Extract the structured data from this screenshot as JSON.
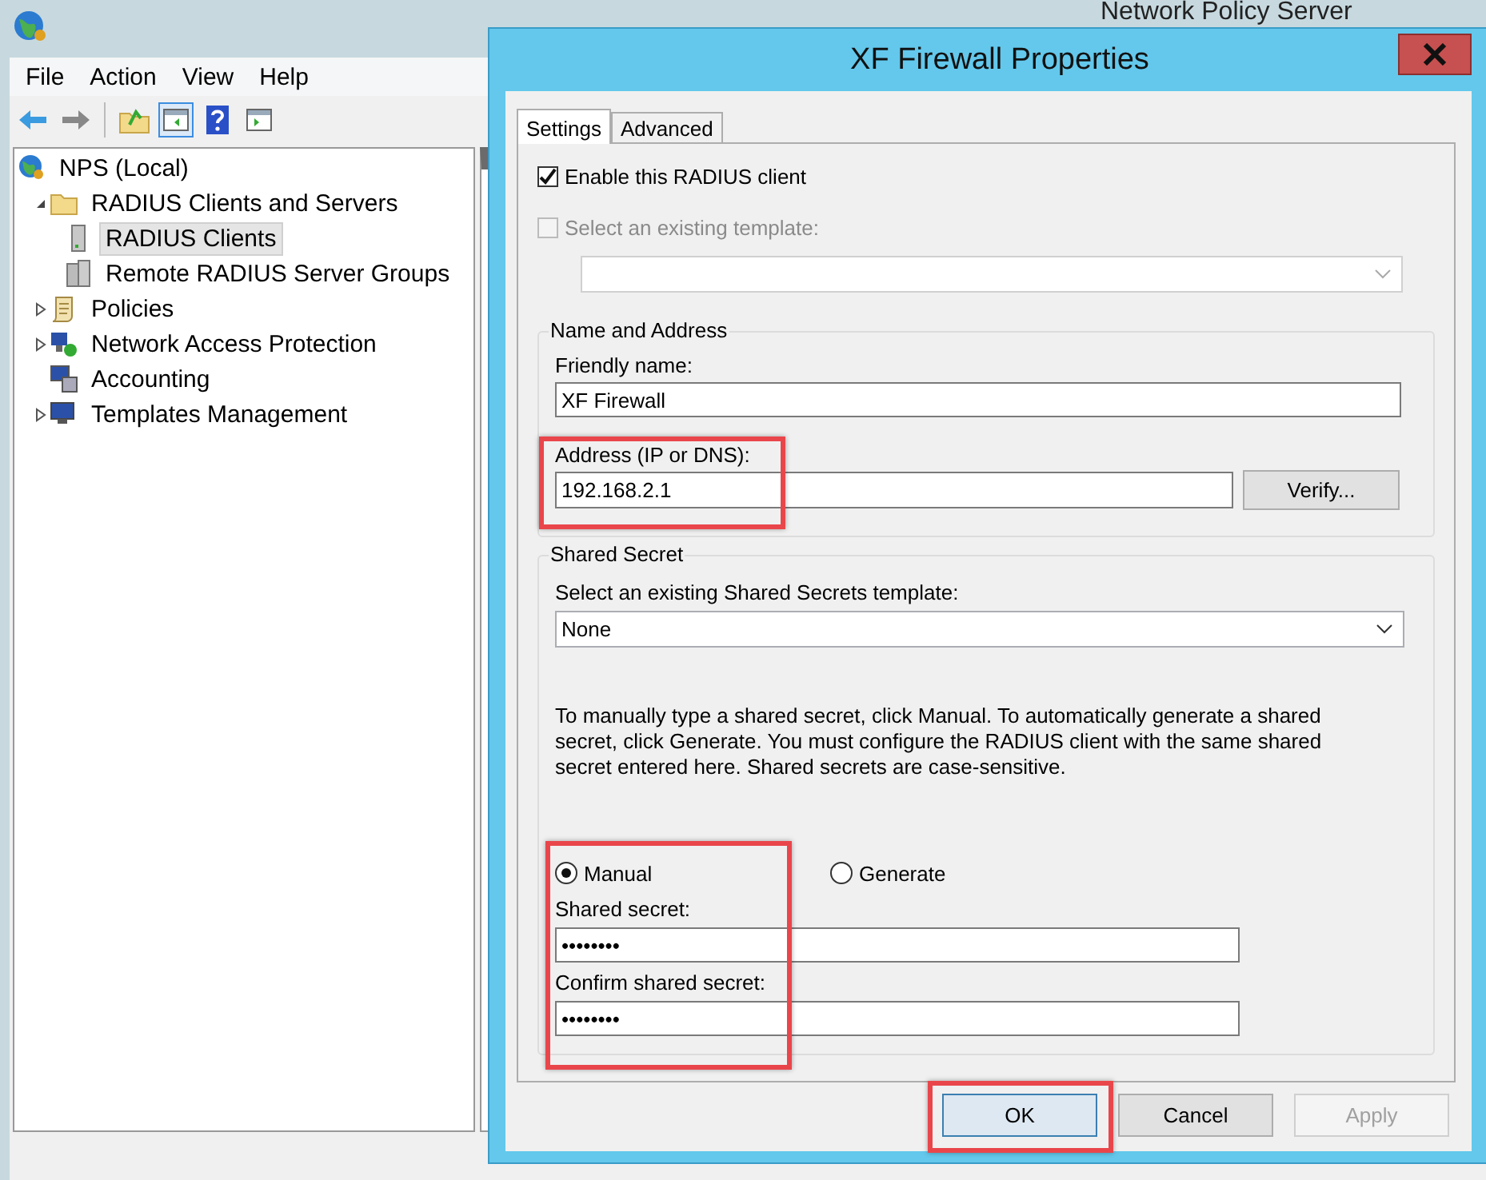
{
  "main_window": {
    "title": "Network Policy Server",
    "menu": [
      "File",
      "Action",
      "View",
      "Help"
    ],
    "tree": [
      {
        "label": "NPS (Local)",
        "kind": "globe",
        "selected": false,
        "children": [
          {
            "label": "RADIUS Clients and Servers",
            "kind": "folder",
            "expanded": true,
            "selected": false,
            "children": [
              {
                "label": "RADIUS Clients",
                "kind": "server",
                "selected": true
              },
              {
                "label": "Remote RADIUS Server Groups",
                "kind": "servers",
                "selected": false
              }
            ]
          },
          {
            "label": "Policies",
            "kind": "scroll",
            "expanded": false,
            "selected": false
          },
          {
            "label": "Network Access Protection",
            "kind": "network",
            "expanded": false,
            "selected": false
          },
          {
            "label": "Accounting",
            "kind": "accounting",
            "selected": false
          },
          {
            "label": "Templates Management",
            "kind": "monitor",
            "expanded": false,
            "selected": false
          }
        ]
      }
    ]
  },
  "dialog": {
    "title": "XF Firewall Properties",
    "tabs": [
      {
        "label": "Settings",
        "selected": true
      },
      {
        "label": "Advanced",
        "selected": false
      }
    ],
    "enable_client": {
      "label": "Enable this RADIUS client",
      "checked": true
    },
    "template": {
      "label": "Select an existing template:",
      "checked": false,
      "disabled": true
    },
    "name_address": {
      "legend": "Name and Address",
      "friendly_name": {
        "label": "Friendly name:",
        "value": "XF Firewall"
      },
      "address": {
        "label": "Address (IP or DNS):",
        "value": "192.168.2.1"
      },
      "verify_button": "Verify..."
    },
    "shared_secret": {
      "legend": "Shared Secret",
      "template_label": "Select an existing Shared Secrets template:",
      "template_value": "None",
      "help": "To manually type a shared secret, click Manual. To automatically generate a shared secret, click Generate. You must configure the RADIUS client with the same shared secret entered here. Shared secrets are case-sensitive.",
      "modes": [
        {
          "label": "Manual",
          "selected": true
        },
        {
          "label": "Generate",
          "selected": false
        }
      ],
      "secret": {
        "label": "Shared secret:",
        "value": "••••••••"
      },
      "confirm": {
        "label": "Confirm shared secret:",
        "value": "••••••••"
      }
    },
    "buttons": [
      {
        "label": "OK",
        "default": true,
        "disabled": false
      },
      {
        "label": "Cancel",
        "default": false,
        "disabled": false
      },
      {
        "label": "Apply",
        "default": false,
        "disabled": true
      }
    ]
  }
}
